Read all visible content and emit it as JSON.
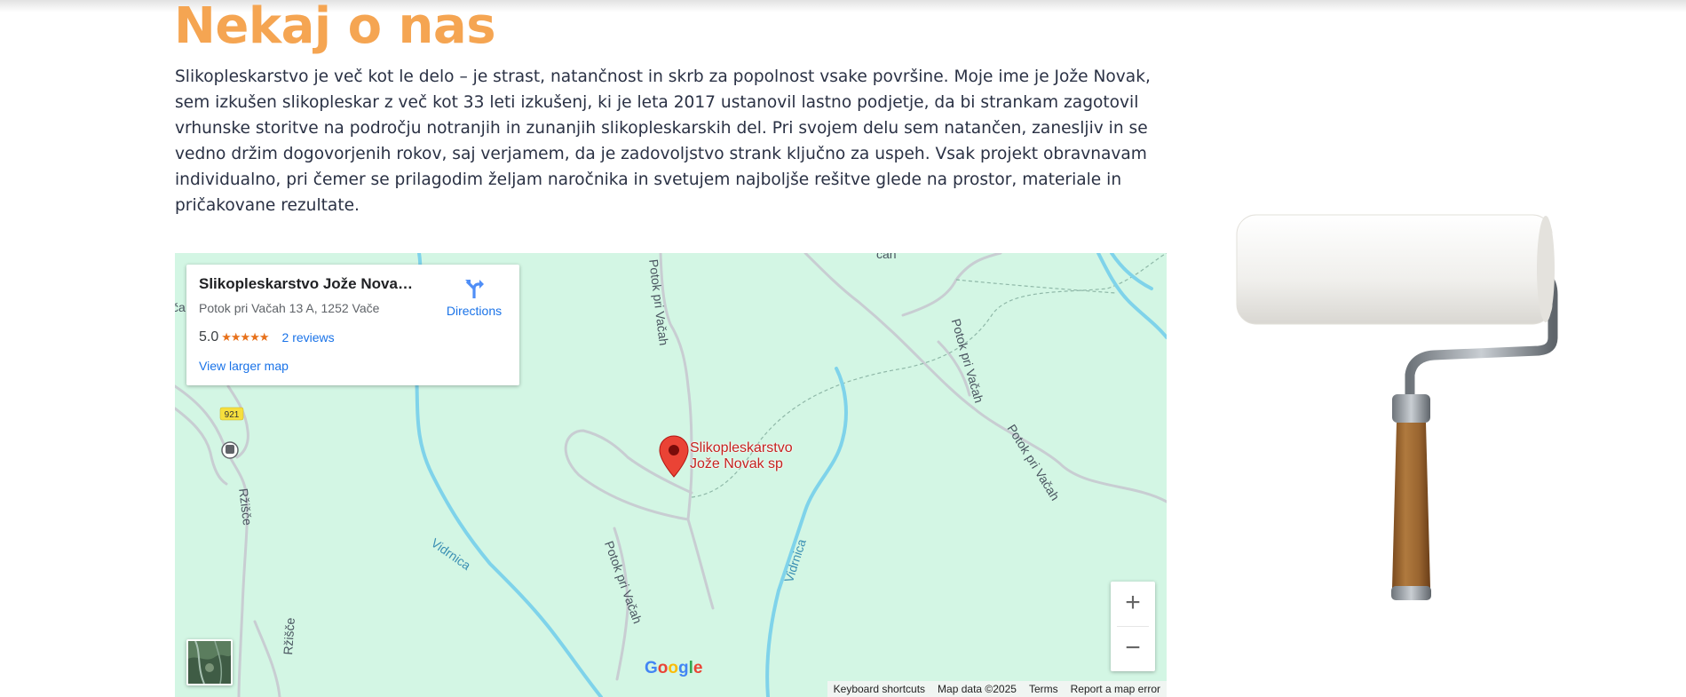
{
  "about": {
    "title": "Nekaj o nas",
    "paragraph": "Slikopleskarstvo je več kot le delo – je strast, natančnost in skrb za popolnost vsake površine. Moje ime je Jože Novak, sem izkušen slikopleskar z več kot 33 leti izkušenj, ki je leta 2017 ustanovil lastno podjetje, da bi strankam zagotovil vrhunske storitve na področju notranjih in zunanjih slikopleskarskih del. Pri svojem delu sem natančen, zanesljiv in se vedno držim dogovorjenih rokov, saj verjamem, da je zadovoljstvo strank ključno za uspeh. Vsak projekt obravnavam individualno, pri čemer se prilagodim željam naročnika in svetujem najboljše rešitve glede na prostor, materiale in pričakovane rezultate."
  },
  "map": {
    "card": {
      "name": "Slikopleskarstvo Jože Novak ...",
      "address": "Potok pri Vačah 13 A, 1252 Vače",
      "rating": "5.0",
      "stars": "★★★★★",
      "reviews": "2 reviews",
      "larger_map": "View larger map",
      "directions": "Directions"
    },
    "pin_label_line1": "Slikopleskarstvo",
    "pin_label_line2": "Jože Novak sp",
    "road_badge": "921",
    "labels": {
      "potok_top": "Potok pri Vačah",
      "potok_right1": "Potok pri Vačah",
      "potok_right2": "Potok pri Vačah",
      "potok_mid": "Potok pri Vačah",
      "vidrnica_left": "Vidrnica",
      "vidrnica_mid": "Vidrnica",
      "rzisce1": "Ržišče",
      "rzisce2": "Ržišče",
      "vacah_top": "čah",
      "left_edge": "ča"
    },
    "zoom_in": "+",
    "zoom_out": "−",
    "google": [
      "G",
      "o",
      "o",
      "g",
      "l",
      "e"
    ],
    "attribution": {
      "shortcuts": "Keyboard shortcuts",
      "map_data": "Map data ©2025",
      "terms": "Terms",
      "report": "Report a map error"
    },
    "colors": {
      "land": "#d3f6e4",
      "water": "#7fd3ea",
      "road": "#c8cdd2",
      "pin": "#ea4335",
      "link": "#1a73e8"
    }
  },
  "colors": {
    "title": "#f5a552",
    "text": "#2a3144"
  }
}
